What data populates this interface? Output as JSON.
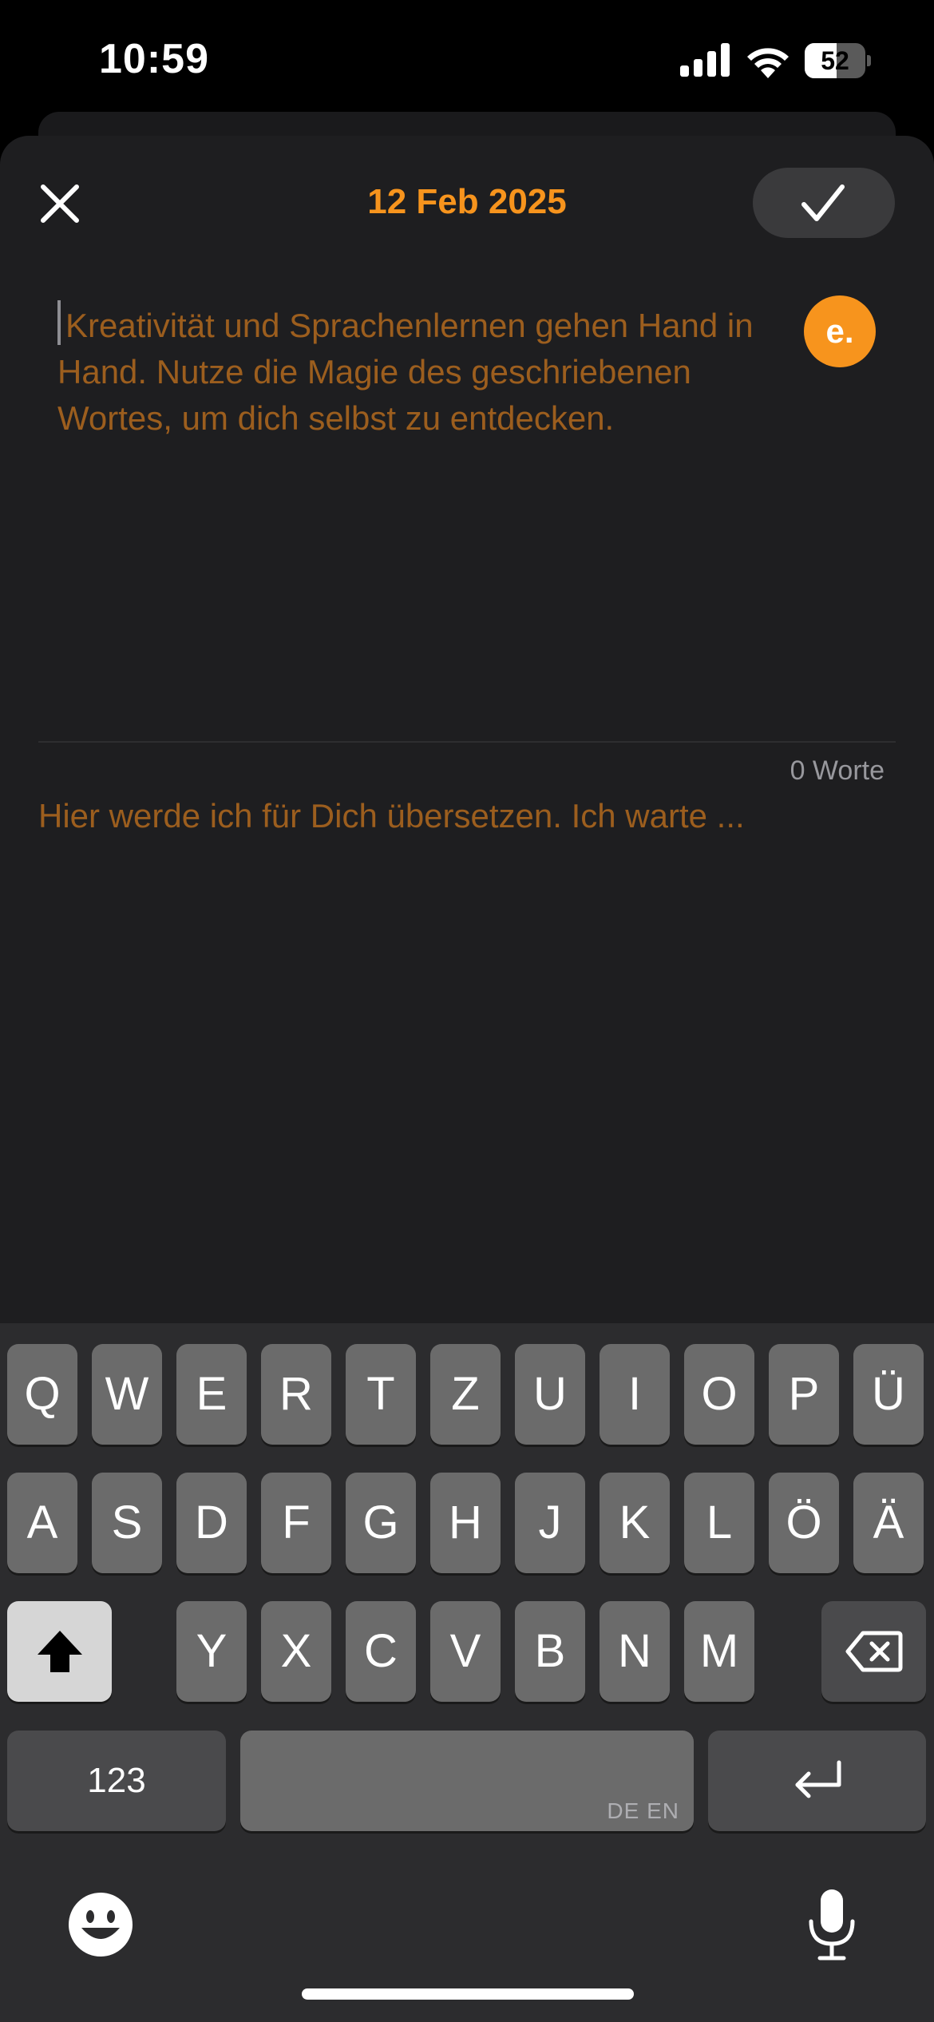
{
  "status_bar": {
    "time": "10:59",
    "battery_level": "52",
    "battery_fraction": 0.52
  },
  "header": {
    "title": "12 Feb 2025",
    "close_icon": "close-icon",
    "done_icon": "checkmark-icon"
  },
  "editor": {
    "placeholder": "Kreativität und Sprachenlernen gehen Hand in Hand. Nutze die Magie des geschriebenen Wortes, um dich selbst zu entdecken.",
    "value": "",
    "avatar_label": "e."
  },
  "word_count": "0 Worte",
  "translation_placeholder": "Hier werde ich für Dich übersetzen. Ich warte ...",
  "colors": {
    "accent": "#f7941d",
    "placeholder_text": "#9c5e1e",
    "sheet_background": "#1e1e20",
    "keyboard_background": "#2c2c2e",
    "key": "#6b6b6b"
  },
  "keyboard": {
    "row1": [
      "Q",
      "W",
      "E",
      "R",
      "T",
      "Z",
      "U",
      "I",
      "O",
      "P",
      "Ü"
    ],
    "row2": [
      "A",
      "S",
      "D",
      "F",
      "G",
      "H",
      "J",
      "K",
      "L",
      "Ö",
      "Ä"
    ],
    "row3": [
      "Y",
      "X",
      "C",
      "V",
      "B",
      "N",
      "M"
    ],
    "numbers_label": "123",
    "space_language_label": "DE EN",
    "shift_icon": "shift-icon",
    "delete_icon": "backspace-icon",
    "return_icon": "return-icon",
    "emoji_icon": "emoji-icon",
    "mic_icon": "microphone-icon"
  }
}
